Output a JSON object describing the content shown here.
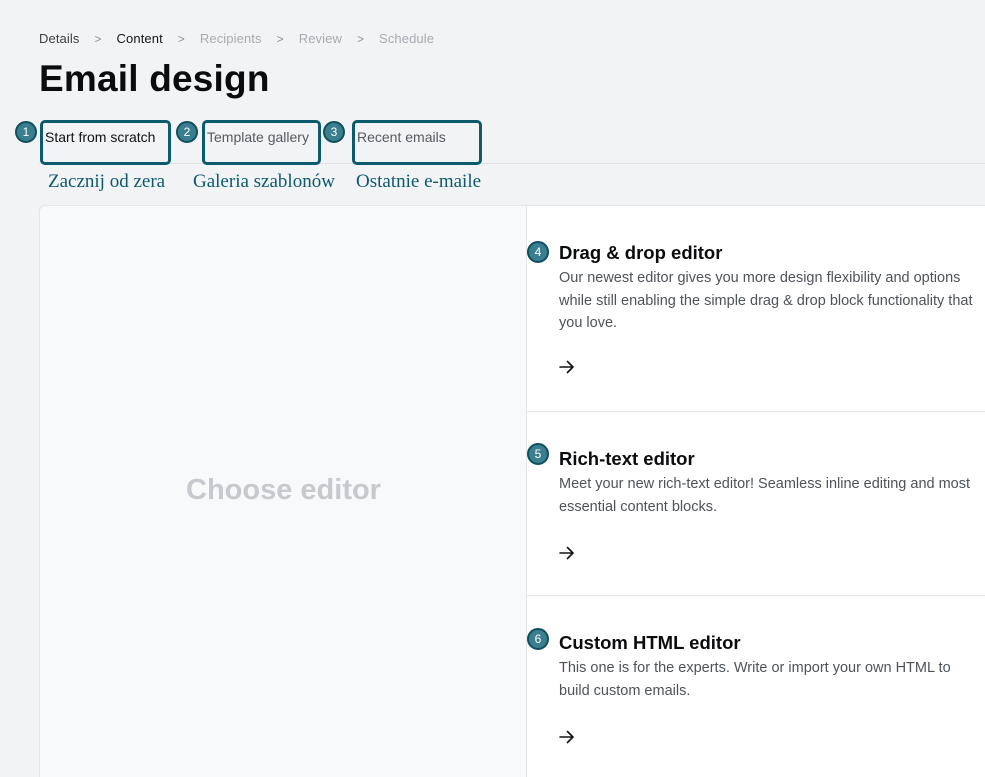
{
  "breadcrumb": [
    {
      "label": "Details",
      "state": "done"
    },
    {
      "label": "Content",
      "state": "current"
    },
    {
      "label": "Recipients",
      "state": "upcoming"
    },
    {
      "label": "Review",
      "state": "upcoming"
    },
    {
      "label": "Schedule",
      "state": "upcoming"
    }
  ],
  "breadcrumb_separator": ">",
  "page_title": "Email design",
  "tabs": [
    {
      "number": "1",
      "label": "Start from scratch",
      "translation": "Zacznij od zera"
    },
    {
      "number": "2",
      "label": "Template gallery",
      "translation": "Galeria szablonów"
    },
    {
      "number": "3",
      "label": "Recent emails",
      "translation": "Ostatnie e-maile"
    }
  ],
  "preview": {
    "placeholder": "Choose editor"
  },
  "editors": [
    {
      "number": "4",
      "title": "Drag & drop editor",
      "description": "Our newest editor gives you more design flexibility and options while still enabling the simple drag & drop block functionality that you love.",
      "icon": "arrow-right-icon"
    },
    {
      "number": "5",
      "title": "Rich-text editor",
      "description": "Meet your new rich-text editor! Seamless inline editing and most essential content blocks.",
      "icon": "arrow-right-icon"
    },
    {
      "number": "6",
      "title": "Custom HTML editor",
      "description": "This one is for the experts. Write or import your own HTML to build custom emails.",
      "icon": "arrow-right-icon"
    }
  ],
  "colors": {
    "annotation": "#0d5a6e",
    "badge": "#3b7f8f",
    "background": "#f2f3f5"
  }
}
